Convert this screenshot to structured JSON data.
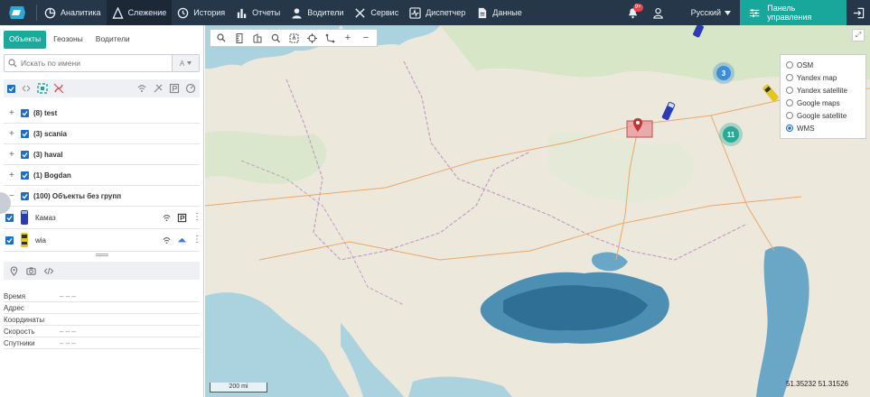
{
  "topbar": {
    "nav": [
      {
        "label": "Аналитика",
        "icon": "analytics-icon"
      },
      {
        "label": "Слежение",
        "icon": "tracking-icon"
      },
      {
        "label": "История",
        "icon": "history-icon"
      },
      {
        "label": "Отчеты",
        "icon": "reports-icon"
      },
      {
        "label": "Водители",
        "icon": "drivers-icon"
      },
      {
        "label": "Сервис",
        "icon": "service-icon"
      },
      {
        "label": "Диспетчер",
        "icon": "dispatcher-icon"
      },
      {
        "label": "Данные",
        "icon": "data-icon"
      }
    ],
    "notification_badge": "9+",
    "language": "Русский",
    "control_panel_label": "Панель управления",
    "accent_color": "#18a79a"
  },
  "sidebar": {
    "tabs": [
      "Объекты",
      "Геозоны",
      "Водители"
    ],
    "search_placeholder": "Искать по имени",
    "sort_label": "A",
    "groups": [
      {
        "pm": "+",
        "label": "(8) test"
      },
      {
        "pm": "+",
        "label": "(3) scania"
      },
      {
        "pm": "+",
        "label": "(3) haval"
      },
      {
        "pm": "+",
        "label": "(1) Bogdan"
      },
      {
        "pm": "−",
        "label": "(100) Объекты без групп"
      }
    ],
    "objects": [
      {
        "name": "Камаз"
      },
      {
        "name": "wia"
      }
    ],
    "info": [
      {
        "key": "Время",
        "value": "– – –"
      },
      {
        "key": "Адрес",
        "value": ""
      },
      {
        "key": "Координаты",
        "value": ""
      },
      {
        "key": "Скорость",
        "value": "– – –"
      },
      {
        "key": "Спутники",
        "value": "– – –"
      }
    ]
  },
  "map": {
    "layers": [
      {
        "label": "OSM",
        "selected": false
      },
      {
        "label": "Yandex map",
        "selected": false
      },
      {
        "label": "Yandex satellite",
        "selected": false
      },
      {
        "label": "Google maps",
        "selected": false
      },
      {
        "label": "Google satellite",
        "selected": false
      },
      {
        "label": "WMS",
        "selected": true
      }
    ],
    "clusters": [
      "3",
      "11"
    ],
    "scale_label": "200 mi",
    "coordinates": "51.35232 51.31526"
  }
}
